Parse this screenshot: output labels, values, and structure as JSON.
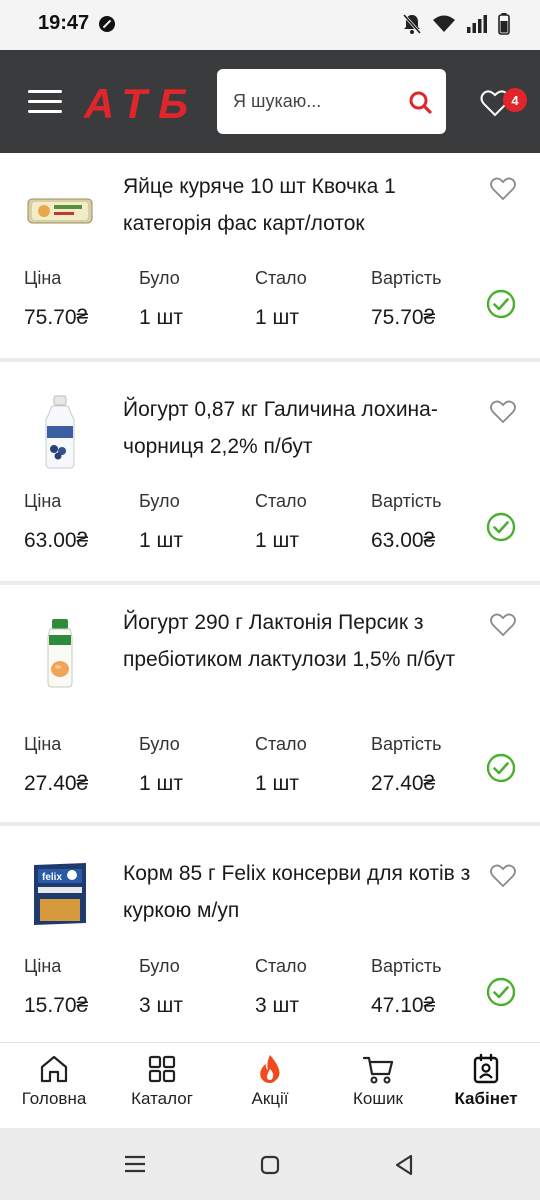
{
  "status_bar": {
    "time": "19:47"
  },
  "header": {
    "logo_text": "АТБ",
    "search_placeholder": "Я шукаю...",
    "favorites_count": "4"
  },
  "labels": {
    "price": "Ціна",
    "was": "Було",
    "now": "Стало",
    "total": "Вартість"
  },
  "products": [
    {
      "title": "Яйце куряче 10 шт Квочка 1 категорія фас карт/лоток",
      "price": "75.70₴",
      "was": "1 шт",
      "now": "1 шт",
      "total": "75.70₴",
      "checked": true
    },
    {
      "title": "Йогурт 0,87 кг Галичина лохина-чорниця 2,2% п/бут",
      "price": "63.00₴",
      "was": "1 шт",
      "now": "1 шт",
      "total": "63.00₴",
      "checked": true
    },
    {
      "title": "Йогурт 290 г Лактонія Персик з пребіотиком лактулози 1,5% п/бут",
      "price": "27.40₴",
      "was": "1 шт",
      "now": "1 шт",
      "total": "27.40₴",
      "checked": true
    },
    {
      "title": "Корм 85 г Felix консерви для котів з куркою м/уп",
      "price": "15.70₴",
      "was": "3 шт",
      "now": "3 шт",
      "total": "47.10₴",
      "checked": true
    }
  ],
  "bottom_nav": [
    {
      "label": "Головна",
      "icon": "home-icon"
    },
    {
      "label": "Каталог",
      "icon": "grid-icon"
    },
    {
      "label": "Акції",
      "icon": "fire-icon"
    },
    {
      "label": "Кошик",
      "icon": "cart-icon"
    },
    {
      "label": "Кабінет",
      "icon": "profile-icon",
      "active": true
    }
  ],
  "colors": {
    "brand_red": "#e0262b",
    "header_bg": "#3a3b3d",
    "check_green": "#4caf32",
    "fire_orange": "#f04a1e"
  }
}
